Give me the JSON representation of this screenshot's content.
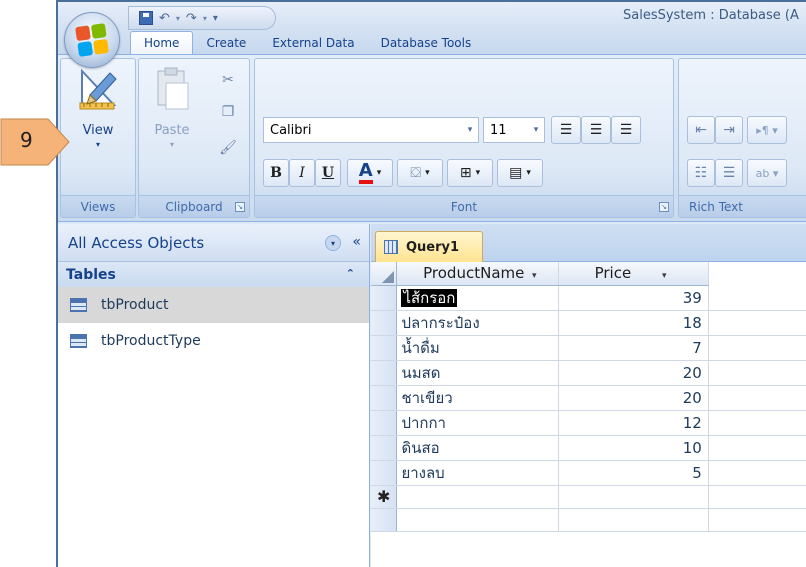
{
  "window": {
    "title": "SalesSystem : Database (A"
  },
  "step_marker": {
    "label": "9",
    "color": "#f5b37a"
  },
  "ribbon": {
    "tabs": [
      {
        "label": "Home",
        "active": true
      },
      {
        "label": "Create",
        "active": false
      },
      {
        "label": "External Data",
        "active": false
      },
      {
        "label": "Database Tools",
        "active": false
      }
    ],
    "groups": {
      "views": {
        "label": "Views",
        "view_button": "View"
      },
      "clipboard": {
        "label": "Clipboard",
        "paste_button": "Paste"
      },
      "font": {
        "label": "Font",
        "font_name": "Calibri",
        "font_size": "11",
        "bold": "B",
        "italic": "I",
        "underline": "U",
        "font_color_glyph": "A"
      },
      "rich_text": {
        "label": "Rich Text"
      }
    }
  },
  "nav_pane": {
    "title": "All Access Objects",
    "collapse_glyph": "«",
    "section": "Tables",
    "items": [
      {
        "label": "tbProduct",
        "selected": true
      },
      {
        "label": "tbProductType",
        "selected": false
      }
    ]
  },
  "document": {
    "tab_label": "Query1",
    "columns": [
      "ProductName",
      "Price"
    ],
    "rows": [
      {
        "name": "ไส้กรอก",
        "price": "39"
      },
      {
        "name": "ปลากระป๋อง",
        "price": "18"
      },
      {
        "name": "น้ำดื่ม",
        "price": "7"
      },
      {
        "name": "นมสด",
        "price": "20"
      },
      {
        "name": "ชาเขียว",
        "price": "20"
      },
      {
        "name": "ปากกา",
        "price": "12"
      },
      {
        "name": "ดินสอ",
        "price": "10"
      },
      {
        "name": "ยางลบ",
        "price": "5"
      }
    ],
    "new_row_marker": "✱"
  }
}
